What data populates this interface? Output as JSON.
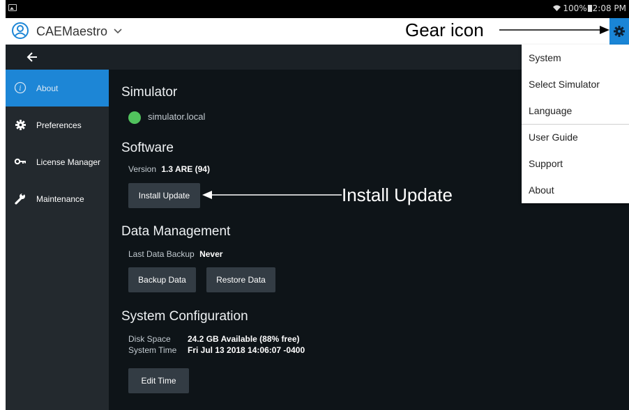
{
  "status_bar": {
    "wifi_icon": "wifi-icon",
    "battery": "100%",
    "time": "2:08 PM"
  },
  "app_bar": {
    "app_name": "CAEMaestro",
    "menu_icon": "chevron-down-icon",
    "settings_icon": "gear-icon"
  },
  "sidebar": {
    "items": [
      {
        "label": "About",
        "icon": "info-icon",
        "active": true
      },
      {
        "label": "Preferences",
        "icon": "gear-icon",
        "active": false
      },
      {
        "label": "License Manager",
        "icon": "key-icon",
        "active": false
      },
      {
        "label": "Maintenance",
        "icon": "wrench-icon",
        "active": false
      }
    ]
  },
  "main": {
    "simulator": {
      "heading": "Simulator",
      "host": "simulator.local",
      "status_color": "#51c25d"
    },
    "software": {
      "heading": "Software",
      "version_label": "Version",
      "version_value": "1.3 ARE (94)",
      "install_button": "Install Update"
    },
    "data_management": {
      "heading": "Data Management",
      "backup_label": "Last Data Backup",
      "backup_value": "Never",
      "backup_button": "Backup Data",
      "restore_button": "Restore Data"
    },
    "system_config": {
      "heading": "System Configuration",
      "disk_label": "Disk Space",
      "disk_value": "24.2 GB Available (88% free)",
      "time_label": "System Time",
      "time_value": "Fri Jul 13 2018 14:06:07 -0400",
      "edit_button": "Edit Time"
    }
  },
  "settings_menu": {
    "items": [
      "System",
      "Select Simulator",
      "Language",
      "User Guide",
      "Support",
      "About"
    ]
  },
  "annotations": {
    "gear": "Gear icon",
    "install": "Install Update"
  },
  "colors": {
    "accent": "#1d86d6",
    "sidebar_bg": "#23292e",
    "content_bg": "#0e1418",
    "button_bg": "#333c44"
  }
}
